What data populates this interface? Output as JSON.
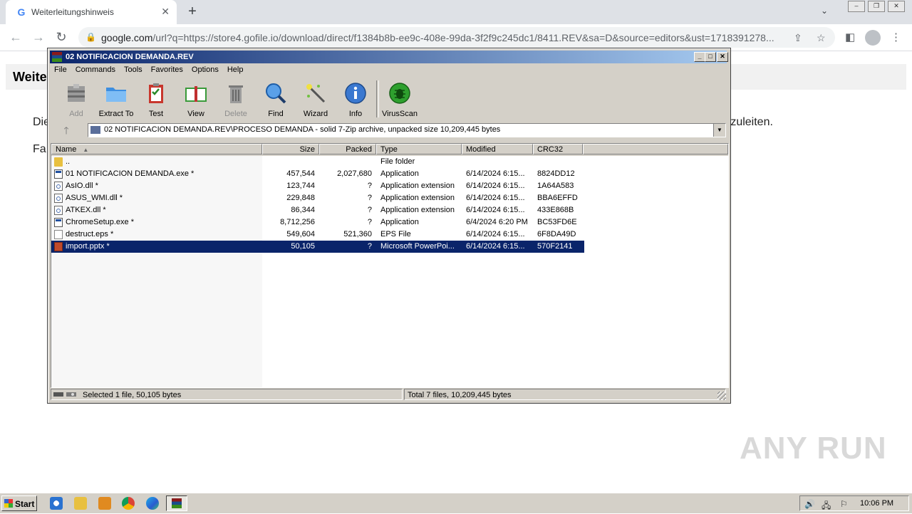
{
  "browser": {
    "tab_title": "Weiterleitungshinweis",
    "tab_favicon": "G",
    "url_host": "google.com",
    "url_rest": "/url?q=https://store4.gofile.io/download/direct/f1384b8b-ee9c-408e-99da-3f2f9c245dc1/8411.REV&sa=D&source=editors&ust=1718391278...",
    "lock_icon": "lock-icon"
  },
  "page": {
    "title_visible": "Weite",
    "line1_left": "Die",
    "line1_right": "rzuleiten.",
    "line2_left": "Fa"
  },
  "winrar": {
    "title": "02 NOTIFICACION DEMANDA.REV",
    "menu": [
      "File",
      "Commands",
      "Tools",
      "Favorites",
      "Options",
      "Help"
    ],
    "toolbar": [
      {
        "label": "Add",
        "icon": "add-archive-icon",
        "disabled": true
      },
      {
        "label": "Extract To",
        "icon": "extract-folder-icon",
        "disabled": false
      },
      {
        "label": "Test",
        "icon": "test-clipboard-icon",
        "disabled": false
      },
      {
        "label": "View",
        "icon": "view-book-icon",
        "disabled": false
      },
      {
        "label": "Delete",
        "icon": "trash-icon",
        "disabled": true
      },
      {
        "label": "Find",
        "icon": "magnifier-icon",
        "disabled": false
      },
      {
        "label": "Wizard",
        "icon": "wand-icon",
        "disabled": false
      },
      {
        "label": "Info",
        "icon": "info-icon",
        "disabled": false
      },
      {
        "label": "VirusScan",
        "icon": "virus-scan-icon",
        "disabled": false
      }
    ],
    "path": "02 NOTIFICACION DEMANDA.REV\\PROCESO DEMANDA - solid 7-Zip archive, unpacked size 10,209,445 bytes",
    "columns": [
      "Name",
      "Size",
      "Packed",
      "Type",
      "Modified",
      "CRC32"
    ],
    "rows": [
      {
        "name": "..",
        "size": "",
        "packed": "",
        "type": "File folder",
        "modified": "",
        "crc": "",
        "icon": "folder"
      },
      {
        "name": "01 NOTIFICACION DEMANDA.exe *",
        "size": "457,544",
        "packed": "2,027,680",
        "type": "Application",
        "modified": "6/14/2024 6:15...",
        "crc": "8824DD12",
        "icon": "exe"
      },
      {
        "name": "AsIO.dll *",
        "size": "123,744",
        "packed": "?",
        "type": "Application extension",
        "modified": "6/14/2024 6:15...",
        "crc": "1A64A583",
        "icon": "dll"
      },
      {
        "name": "ASUS_WMI.dll *",
        "size": "229,848",
        "packed": "?",
        "type": "Application extension",
        "modified": "6/14/2024 6:15...",
        "crc": "BBA6EFFD",
        "icon": "dll"
      },
      {
        "name": "ATKEX.dll *",
        "size": "86,344",
        "packed": "?",
        "type": "Application extension",
        "modified": "6/14/2024 6:15...",
        "crc": "433E868B",
        "icon": "dll"
      },
      {
        "name": "ChromeSetup.exe *",
        "size": "8,712,256",
        "packed": "?",
        "type": "Application",
        "modified": "6/4/2024 6:20 PM",
        "crc": "BC53FD6E",
        "icon": "exe"
      },
      {
        "name": "destruct.eps *",
        "size": "549,604",
        "packed": "521,360",
        "type": "EPS File",
        "modified": "6/14/2024 6:15...",
        "crc": "6F8DA49D",
        "icon": "eps"
      },
      {
        "name": "import.pptx *",
        "size": "50,105",
        "packed": "?",
        "type": "Microsoft PowerPoi...",
        "modified": "6/14/2024 6:15...",
        "crc": "570F2141",
        "icon": "pptx",
        "selected": true
      }
    ],
    "status_left": "Selected 1 file, 50,105 bytes",
    "status_right": "Total 7 files, 10,209,445 bytes"
  },
  "taskbar": {
    "start_label": "Start",
    "clock": "10:06 PM"
  },
  "watermark": "ANY RUN"
}
